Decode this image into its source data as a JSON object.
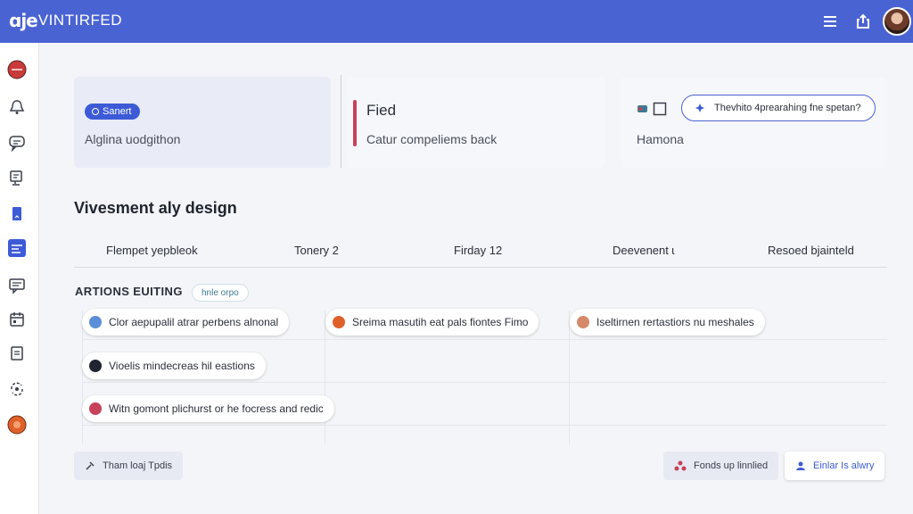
{
  "header": {
    "brand_mark": "ɑjе",
    "brand_text": "VINTIRFED",
    "colors": {
      "bar": "#4a63d3"
    },
    "icons": [
      "menu-icon",
      "share-icon",
      "user-avatar"
    ]
  },
  "sidebar": {
    "items": [
      {
        "icon": "red-circle-icon",
        "color": "#c93a3a"
      },
      {
        "icon": "bell-icon"
      },
      {
        "icon": "chat-icon"
      },
      {
        "icon": "monitor-icon"
      },
      {
        "icon": "bookmark-icon",
        "color": "#4a63d3"
      },
      {
        "icon": "dashboard-icon",
        "color": "#4a63d3"
      },
      {
        "icon": "message-icon"
      },
      {
        "icon": "calendar-icon"
      },
      {
        "icon": "document-icon"
      },
      {
        "icon": "sync-icon"
      },
      {
        "icon": "orange-circle-icon",
        "color": "#e0602a"
      }
    ]
  },
  "cards": {
    "card1": {
      "pill": "Sanert",
      "subtitle": "Alglina uodgithon"
    },
    "card2": {
      "title": "Fied",
      "subtitle": "Catur compeliems back"
    },
    "card3": {
      "search_text": "Thevhito 4prearahing fne spetan?",
      "subtitle": "Hamona"
    }
  },
  "main": {
    "section_title": "Vivesment aly design",
    "columns": [
      "Flempet yepbleok",
      "Tonery 2",
      "Firday 12",
      "Deevenent ɩ",
      "Resoed bjainteld"
    ],
    "subsection": {
      "title": "ARTIONS EUITING",
      "tag": "hnle orpo"
    },
    "chips": [
      {
        "label": "Clor aepupalil atrar perbens alnonal",
        "icon_color": "#5a8fd8"
      },
      {
        "label": "Sreima masutih eat pals fiontes Fimo",
        "icon_color": "#e0602a"
      },
      {
        "label": "Iseltirnen rertastiors nu meshales",
        "icon_color": "#d58a6a"
      },
      {
        "label": "Vioelis mindecreas hil eastions",
        "icon_color": "#1f2430"
      },
      {
        "label": "Witn gomont plichurst or he focress and redic",
        "icon_color": "#c6425a"
      }
    ]
  },
  "footer": {
    "left_label": "Tham loaj Tpdis",
    "mid_label": "Fonds up linnlied",
    "right_label": "Einlar Is alwry"
  }
}
